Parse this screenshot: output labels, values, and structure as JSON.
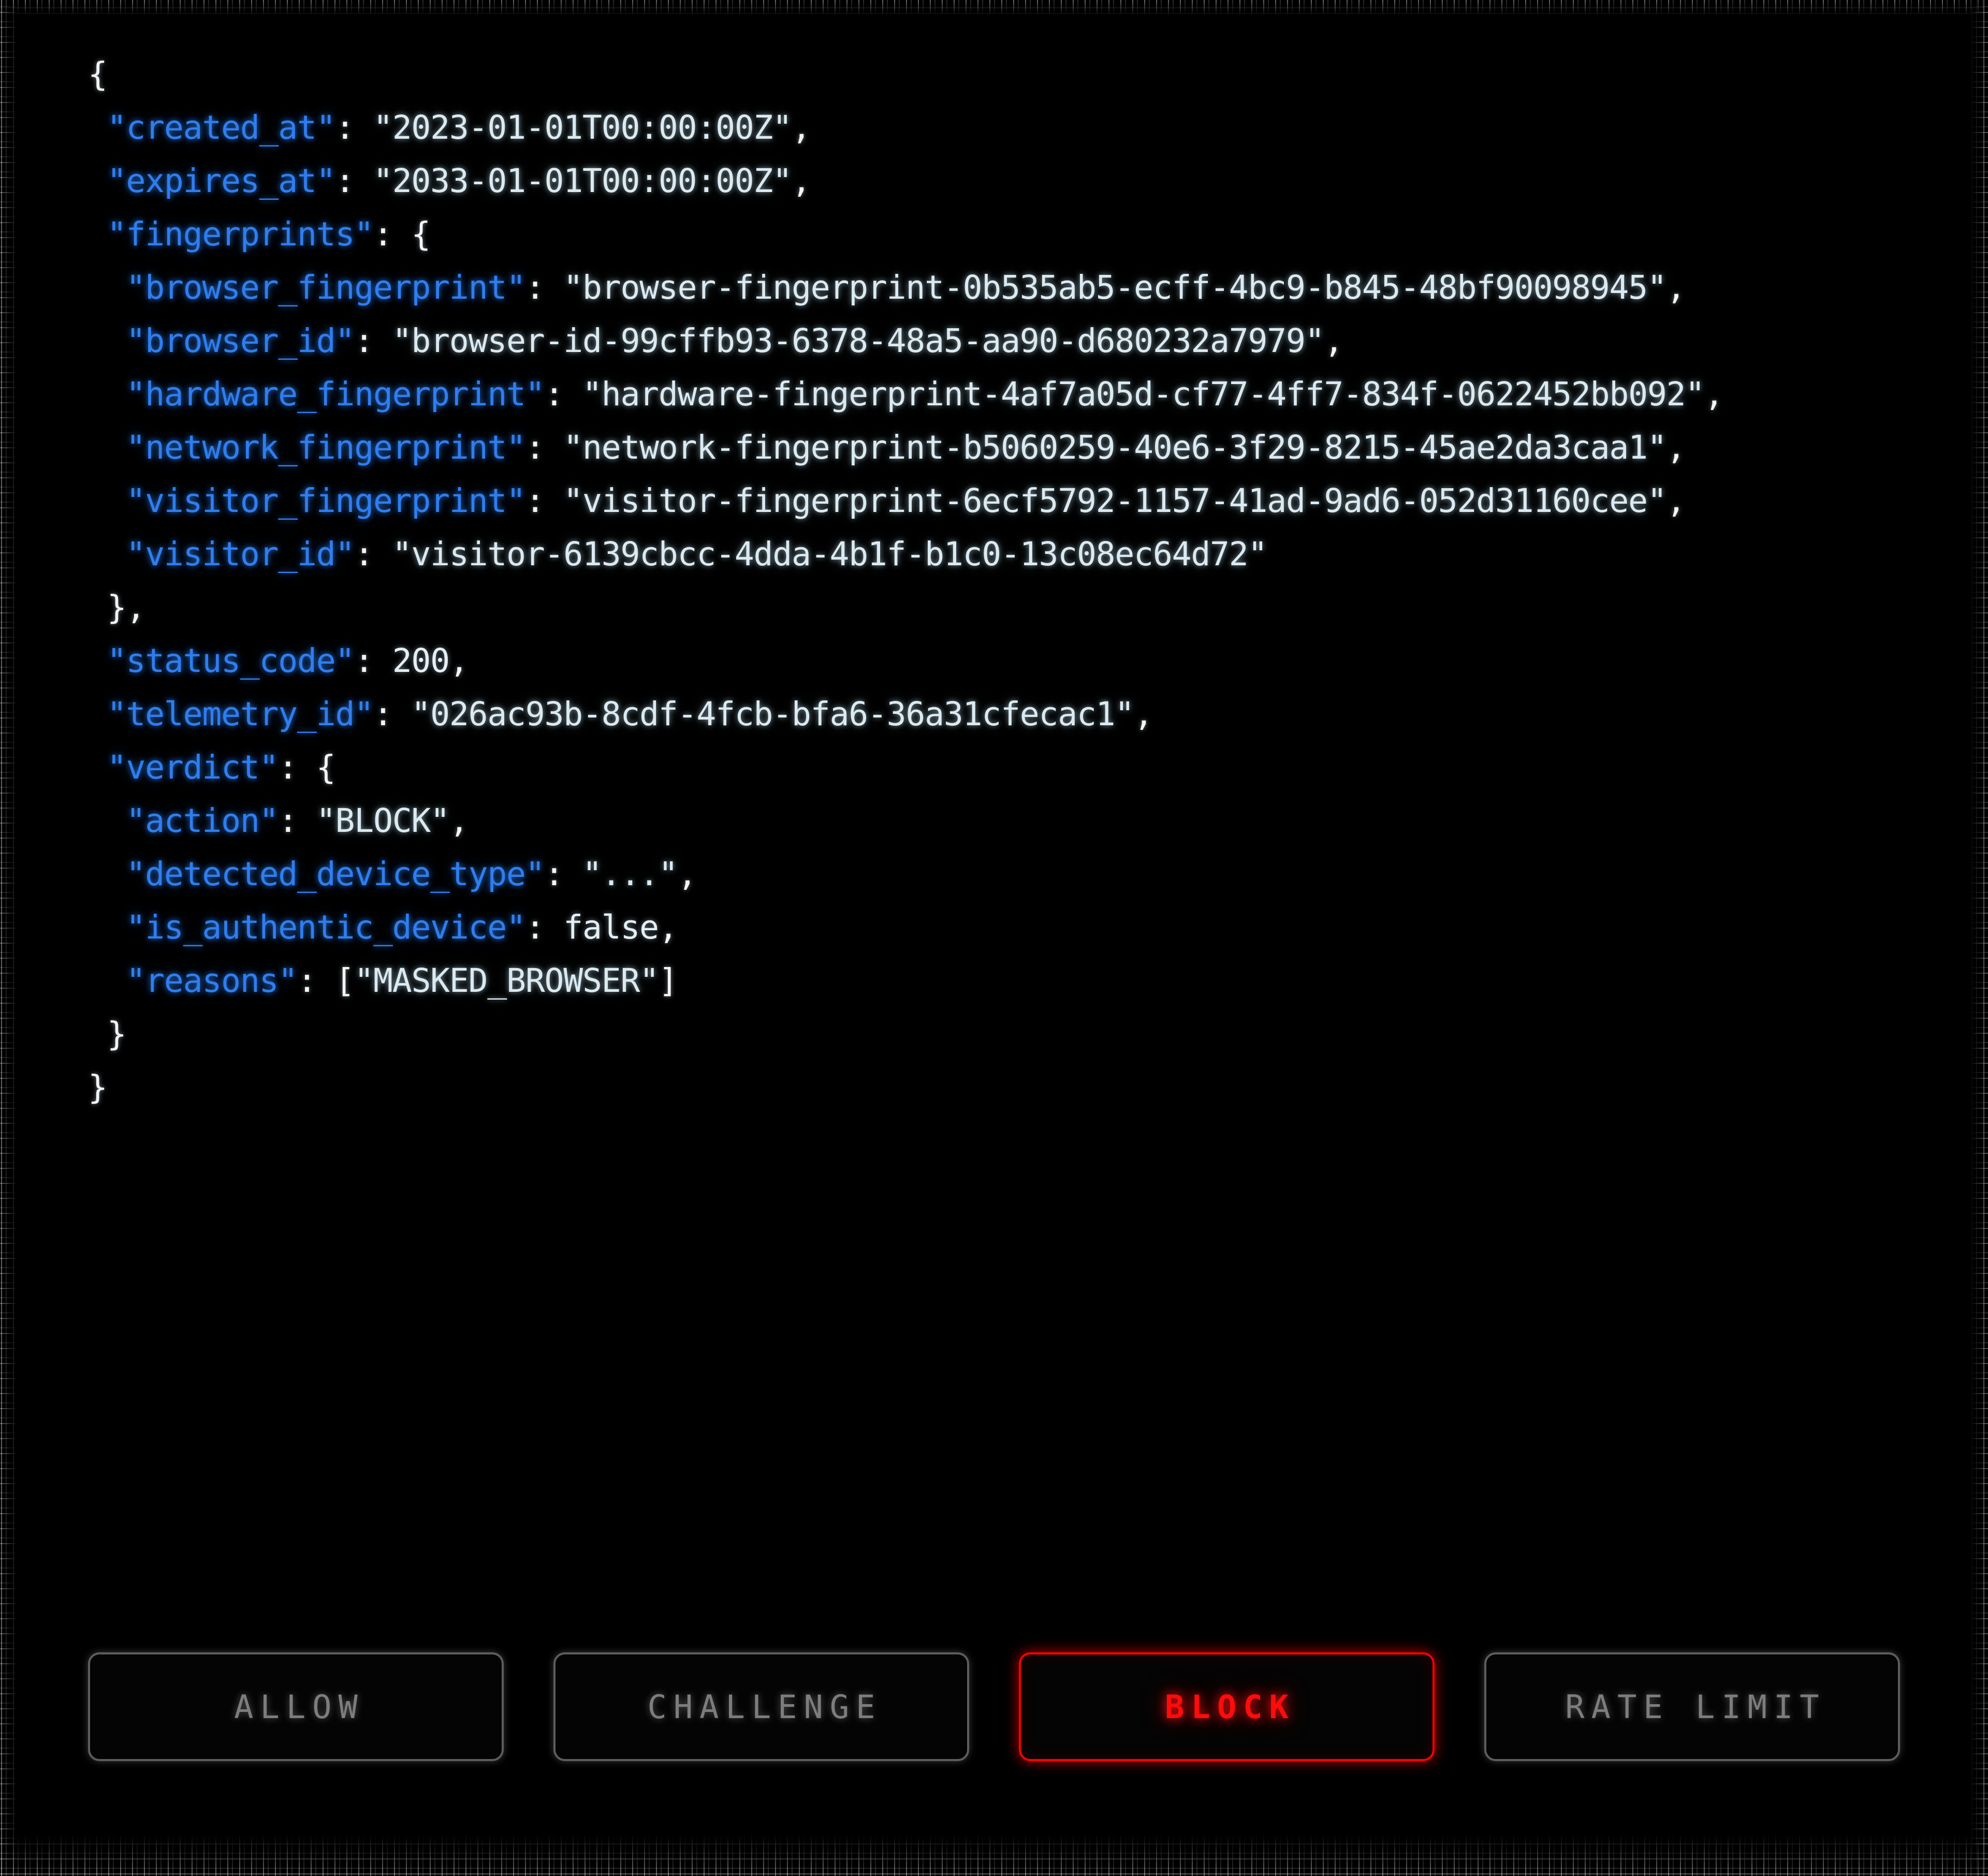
{
  "json_document": {
    "lines": [
      {
        "indent": 0,
        "parts": [
          {
            "t": "punct",
            "v": "{"
          }
        ]
      },
      {
        "indent": 1,
        "parts": [
          {
            "t": "key",
            "v": "\"created_at\""
          },
          {
            "t": "punct",
            "v": ": "
          },
          {
            "t": "val",
            "v": "\"2023-01-01T00:00:00Z\""
          },
          {
            "t": "punct",
            "v": ","
          }
        ]
      },
      {
        "indent": 1,
        "parts": [
          {
            "t": "key",
            "v": "\"expires_at\""
          },
          {
            "t": "punct",
            "v": ": "
          },
          {
            "t": "val",
            "v": "\"2033-01-01T00:00:00Z\""
          },
          {
            "t": "punct",
            "v": ","
          }
        ]
      },
      {
        "indent": 1,
        "parts": [
          {
            "t": "key",
            "v": "\"fingerprints\""
          },
          {
            "t": "punct",
            "v": ": {"
          }
        ]
      },
      {
        "indent": 2,
        "parts": [
          {
            "t": "key",
            "v": "\"browser_fingerprint\""
          },
          {
            "t": "punct",
            "v": ": "
          },
          {
            "t": "val",
            "v": "\"browser-fingerprint-0b535ab5-ecff-4bc9-b845-48bf90098945\""
          },
          {
            "t": "punct",
            "v": ","
          }
        ]
      },
      {
        "indent": 2,
        "parts": [
          {
            "t": "key",
            "v": "\"browser_id\""
          },
          {
            "t": "punct",
            "v": ": "
          },
          {
            "t": "val",
            "v": "\"browser-id-99cffb93-6378-48a5-aa90-d680232a7979\""
          },
          {
            "t": "punct",
            "v": ","
          }
        ]
      },
      {
        "indent": 2,
        "parts": [
          {
            "t": "key",
            "v": "\"hardware_fingerprint\""
          },
          {
            "t": "punct",
            "v": ": "
          },
          {
            "t": "val",
            "v": "\"hardware-fingerprint-4af7a05d-cf77-4ff7-834f-0622452bb092\""
          },
          {
            "t": "punct",
            "v": ","
          }
        ]
      },
      {
        "indent": 2,
        "parts": [
          {
            "t": "key",
            "v": "\"network_fingerprint\""
          },
          {
            "t": "punct",
            "v": ": "
          },
          {
            "t": "val",
            "v": "\"network-fingerprint-b5060259-40e6-3f29-8215-45ae2da3caa1\""
          },
          {
            "t": "punct",
            "v": ","
          }
        ]
      },
      {
        "indent": 2,
        "parts": [
          {
            "t": "key",
            "v": "\"visitor_fingerprint\""
          },
          {
            "t": "punct",
            "v": ": "
          },
          {
            "t": "val",
            "v": "\"visitor-fingerprint-6ecf5792-1157-41ad-9ad6-052d31160cee\""
          },
          {
            "t": "punct",
            "v": ","
          }
        ]
      },
      {
        "indent": 2,
        "parts": [
          {
            "t": "key",
            "v": "\"visitor_id\""
          },
          {
            "t": "punct",
            "v": ": "
          },
          {
            "t": "val",
            "v": "\"visitor-6139cbcc-4dda-4b1f-b1c0-13c08ec64d72\""
          }
        ]
      },
      {
        "indent": 1,
        "parts": [
          {
            "t": "punct",
            "v": "},"
          }
        ]
      },
      {
        "indent": 1,
        "parts": [
          {
            "t": "key",
            "v": "\"status_code\""
          },
          {
            "t": "punct",
            "v": ": "
          },
          {
            "t": "num",
            "v": "200"
          },
          {
            "t": "punct",
            "v": ","
          }
        ]
      },
      {
        "indent": 1,
        "parts": [
          {
            "t": "key",
            "v": "\"telemetry_id\""
          },
          {
            "t": "punct",
            "v": ": "
          },
          {
            "t": "val",
            "v": "\"026ac93b-8cdf-4fcb-bfa6-36a31cfecac1\""
          },
          {
            "t": "punct",
            "v": ","
          }
        ]
      },
      {
        "indent": 1,
        "parts": [
          {
            "t": "key",
            "v": "\"verdict\""
          },
          {
            "t": "punct",
            "v": ": {"
          }
        ]
      },
      {
        "indent": 2,
        "parts": [
          {
            "t": "key",
            "v": "\"action\""
          },
          {
            "t": "punct",
            "v": ": "
          },
          {
            "t": "val",
            "v": "\"BLOCK\""
          },
          {
            "t": "punct",
            "v": ","
          }
        ]
      },
      {
        "indent": 2,
        "parts": [
          {
            "t": "key",
            "v": "\"detected_device_type\""
          },
          {
            "t": "punct",
            "v": ": "
          },
          {
            "t": "val",
            "v": "\"...\""
          },
          {
            "t": "punct",
            "v": ","
          }
        ]
      },
      {
        "indent": 2,
        "parts": [
          {
            "t": "key",
            "v": "\"is_authentic_device\""
          },
          {
            "t": "punct",
            "v": ": "
          },
          {
            "t": "bool",
            "v": "false"
          },
          {
            "t": "punct",
            "v": ","
          }
        ]
      },
      {
        "indent": 2,
        "parts": [
          {
            "t": "key",
            "v": "\"reasons\""
          },
          {
            "t": "punct",
            "v": ": ["
          },
          {
            "t": "val",
            "v": "\"MASKED_BROWSER\""
          },
          {
            "t": "punct",
            "v": "]"
          }
        ]
      },
      {
        "indent": 1,
        "parts": [
          {
            "t": "punct",
            "v": "}"
          }
        ]
      },
      {
        "indent": 0,
        "parts": [
          {
            "t": "punct",
            "v": "}"
          }
        ]
      }
    ],
    "fields": {
      "created_at": "2023-01-01T00:00:00Z",
      "expires_at": "2033-01-01T00:00:00Z",
      "fingerprints": {
        "browser_fingerprint": "browser-fingerprint-0b535ab5-ecff-4bc9-b845-48bf90098945",
        "browser_id": "browser-id-99cffb93-6378-48a5-aa90-d680232a7979",
        "hardware_fingerprint": "hardware-fingerprint-4af7a05d-cf77-4ff7-834f-0622452bb092",
        "network_fingerprint": "network-fingerprint-b5060259-40e6-3f29-8215-45ae2da3caa1",
        "visitor_fingerprint": "visitor-fingerprint-6ecf5792-1157-41ad-9ad6-052d31160cee",
        "visitor_id": "visitor-6139cbcc-4dda-4b1f-b1c0-13c08ec64d72"
      },
      "status_code": "200",
      "telemetry_id": "026ac93b-8cdf-4fcb-bfa6-36a31cfecac1",
      "verdict": {
        "action": "BLOCK",
        "detected_device_type": "...",
        "is_authentic_device": "false",
        "reasons": "MASKED_BROWSER"
      }
    }
  },
  "action_bar": {
    "buttons": [
      {
        "label": "ALLOW",
        "name": "allow",
        "active": false
      },
      {
        "label": "CHALLENGE",
        "name": "challenge",
        "active": false
      },
      {
        "label": "BLOCK",
        "name": "block",
        "active": true
      },
      {
        "label": "RATE LIMIT",
        "name": "rate-limit",
        "active": false
      }
    ],
    "selected": "BLOCK"
  },
  "colors": {
    "background": "#000000",
    "json_key": "#2f7ef0",
    "json_value": "#dbeaf0",
    "json_punct": "#f2f4f5",
    "button_idle_border": "#5d5d5d",
    "button_idle_text": "#7d7d7d",
    "button_active": "#ff0000"
  }
}
